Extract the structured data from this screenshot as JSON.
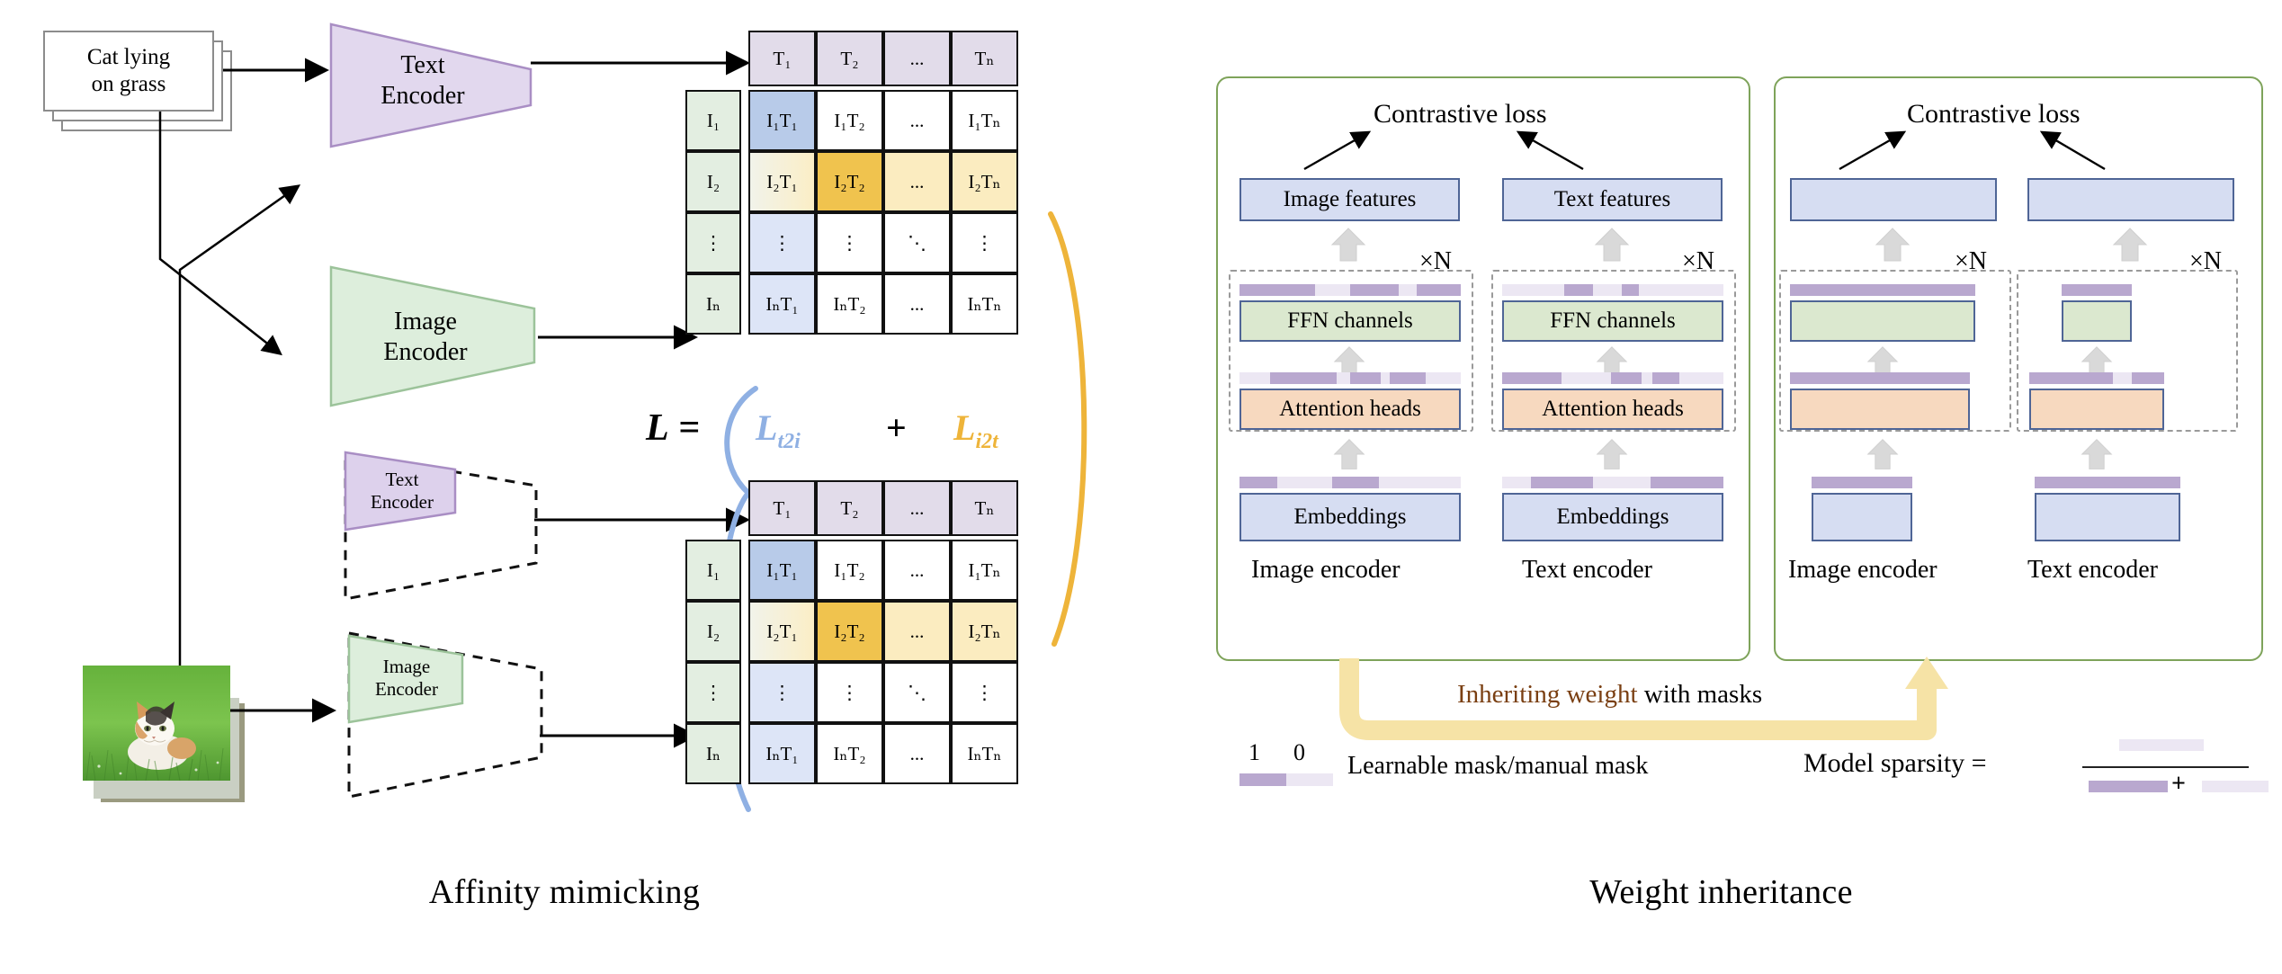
{
  "figure": {
    "left_caption": "Affinity mimicking",
    "right_caption": "Weight inheritance"
  },
  "left": {
    "text_card": "Cat lying\non grass",
    "text_card_line1": "Cat lying",
    "text_card_line2": "on grass",
    "image_card_alt": "cat lying on grass photo",
    "encoders": [
      {
        "name": "teacher-text-encoder",
        "line1": "Text",
        "line2": "Encoder",
        "color": "#e2d8ee",
        "pruned": false
      },
      {
        "name": "teacher-image-encoder",
        "line1": "Image",
        "line2": "Encoder",
        "color": "#ddeedc",
        "pruned": false
      },
      {
        "name": "student-text-encoder",
        "line1": "Text",
        "line2": "Encoder",
        "color": "#e2d8ee",
        "pruned": true
      },
      {
        "name": "student-image-encoder",
        "line1": "Image",
        "line2": "Encoder",
        "color": "#ddeedc",
        "pruned": true
      }
    ],
    "loss": {
      "L": "L",
      "equals": "=",
      "t2i": "L",
      "t2i_sub": "t2i",
      "plus": "+",
      "i2t": "L",
      "i2t_sub": "i2t",
      "t2i_color": "#8fb0e3",
      "i2t_color": "#eeb43a"
    }
  },
  "matrix": {
    "col_headers": [
      "T₁",
      "T₂",
      "...",
      "Tₙ"
    ],
    "col_headers_plain": [
      "T1",
      "T2",
      "...",
      "TN"
    ],
    "row_labels": [
      "I₁",
      "I₂",
      "⋮",
      "Iₙ"
    ],
    "rows": [
      [
        "I₁T₁",
        "I₁T₂",
        "...",
        "I₁Tₙ"
      ],
      [
        "I₂T₁",
        "I₂T₂",
        "...",
        "I₂Tₙ"
      ],
      [
        "⋮",
        "⋮",
        "⋱",
        "⋮"
      ],
      [
        "IₙT₁",
        "IₙT₂",
        "...",
        "IₙTₙ"
      ]
    ],
    "highlight_column_index": 0,
    "highlight_row_index": 1,
    "colors": {
      "header": "#e2dcea",
      "row_label": "#e3eee1",
      "t2i_strong": "#b8cbe9",
      "t2i_weak": "#dde5f7",
      "i2t_strong": "#f0c34e",
      "i2t_weak": "#fbecc0"
    }
  },
  "right": {
    "panels": [
      {
        "id": "teacher-panel",
        "contrastive_loss": "Contrastive loss",
        "columns": [
          {
            "id": "image-encoder-column",
            "feature_box": "Image features",
            "ffn_box": "FFN channels",
            "attention_box": "Attention heads",
            "embeddings_box": "Embeddings",
            "encoder_label": "Image encoder",
            "repeat": "×N",
            "masks": {
              "ffn": [
                1,
                0,
                1,
                0,
                1
              ],
              "attention": [
                0,
                1,
                1,
                1,
                0
              ],
              "embeddings": [
                1,
                0,
                1,
                0,
                0
              ]
            }
          },
          {
            "id": "text-encoder-column",
            "feature_box": "Text features",
            "ffn_box": "FFN channels",
            "attention_box": "Attention heads",
            "embeddings_box": "Embeddings",
            "encoder_label": "Text encoder",
            "repeat": "×N",
            "masks": {
              "ffn": [
                0,
                1,
                0,
                1,
                0
              ],
              "attention": [
                1,
                0,
                1,
                1,
                0
              ],
              "embeddings": [
                0,
                1,
                0,
                1,
                1
              ]
            }
          }
        ]
      },
      {
        "id": "student-panel",
        "contrastive_loss": "Contrastive loss",
        "columns": [
          {
            "id": "image-encoder-column-pruned",
            "feature_box": "",
            "ffn_box": "",
            "attention_box": "",
            "embeddings_box": "",
            "encoder_label": "Image encoder",
            "repeat": "×N",
            "masks": {
              "ffn": [
                1
              ],
              "attention": [
                1
              ],
              "embeddings": [
                1
              ]
            }
          },
          {
            "id": "text-encoder-column-pruned",
            "feature_box": "",
            "ffn_box": "",
            "attention_box": "",
            "embeddings_box": "",
            "encoder_label": "Text encoder",
            "repeat": "×N",
            "masks": {
              "ffn": [
                1
              ],
              "attention": [
                1,
                0,
                1
              ],
              "embeddings": [
                1
              ]
            }
          }
        ]
      }
    ],
    "inherit_arrow": {
      "emphasis": "Inheriting weight",
      "rest": " with masks",
      "color": "#f6e3a6",
      "text_color": "#7a3f12"
    },
    "legend": {
      "one": "1",
      "zero": "0",
      "text": "Learnable mask/manual mask",
      "on_color": "#b9a8cf",
      "off_color": "#ece7f3"
    },
    "sparsity": {
      "label": "Model sparsity =",
      "numerator": "off",
      "denominator_left": "on",
      "denominator_plus": "+",
      "denominator_right": "off"
    }
  }
}
